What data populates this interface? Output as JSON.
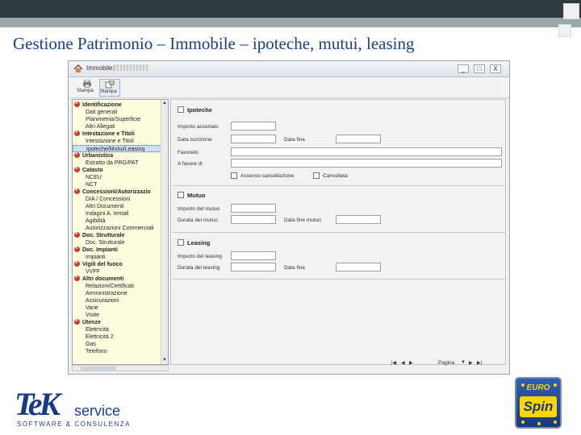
{
  "slide": {
    "title": "Gestione Patrimonio – Immobile – ipoteche, mutui, leasing"
  },
  "window": {
    "title": "Immobile:",
    "buttons": [
      "_",
      "□",
      "X"
    ]
  },
  "toolbar": {
    "buttons": [
      {
        "label": "Stampa",
        "icon": "printer-icon"
      },
      {
        "label": "Stampa",
        "icon": "print-preview-icon"
      }
    ]
  },
  "tree": {
    "items": [
      {
        "text": "Identificazione",
        "type": "group"
      },
      {
        "text": "Dati generali",
        "type": "child"
      },
      {
        "text": "Planimetria/Superficie",
        "type": "child"
      },
      {
        "text": "Altri Allegati",
        "type": "child"
      },
      {
        "text": "Intestazione e Titoli",
        "type": "group"
      },
      {
        "text": "Intestazione e Titoli",
        "type": "child"
      },
      {
        "text": "Ipoteche/Mutui/Leasing",
        "type": "child",
        "selected": true
      },
      {
        "text": "Urbanistica",
        "type": "group"
      },
      {
        "text": "Estratto da PRG/PAT",
        "type": "child"
      },
      {
        "text": "Catasto",
        "type": "group"
      },
      {
        "text": "NCEU",
        "type": "child"
      },
      {
        "text": "NCT",
        "type": "child"
      },
      {
        "text": "Concessioni/Autorizzazio",
        "type": "group"
      },
      {
        "text": "DIA / Concessioni",
        "type": "child"
      },
      {
        "text": "Altri Documenti",
        "type": "child"
      },
      {
        "text": "Indagini A. Ientali",
        "type": "child"
      },
      {
        "text": "Agibilità",
        "type": "child"
      },
      {
        "text": "Autorizzazioni Commerciali",
        "type": "child"
      },
      {
        "text": "Doc. Strutturale",
        "type": "group"
      },
      {
        "text": "Doc. Strutturale",
        "type": "child"
      },
      {
        "text": "Doc. Impianti",
        "type": "group"
      },
      {
        "text": "Impianti",
        "type": "child"
      },
      {
        "text": "Vigili del fuoco",
        "type": "group"
      },
      {
        "text": "VVFF",
        "type": "child"
      },
      {
        "text": "Altri documenti",
        "type": "group"
      },
      {
        "text": "Relazioni/Certificati",
        "type": "child"
      },
      {
        "text": "Amministrazione",
        "type": "child"
      },
      {
        "text": "Assicurazioni",
        "type": "child"
      },
      {
        "text": "Varie",
        "type": "child"
      },
      {
        "text": "Visite",
        "type": "child"
      },
      {
        "text": "Utenze",
        "type": "group"
      },
      {
        "text": "Elettricità",
        "type": "child"
      },
      {
        "text": "Elettricità 2",
        "type": "child"
      },
      {
        "text": "Gas",
        "type": "child"
      },
      {
        "text": "Telefono",
        "type": "child"
      }
    ]
  },
  "form": {
    "ipoteche": {
      "title": "Ipoteche",
      "importo_label": "Importo accertato",
      "data_iscrizione_label": "Data iscrizione",
      "data_fine_label": "Data fine",
      "favoreto_label": "Favoreto",
      "favore_di_label": "A favore di",
      "assenso_label": "Assenso cancellazione",
      "cancellata_label": "Cancellata"
    },
    "mutuo": {
      "title": "Mutuo",
      "importo_label": "Importo del mutuo",
      "durata_label": "Durata del mutuo",
      "data_fine_label": "Data fine mutuo"
    },
    "leasing": {
      "title": "Leasing",
      "importo_label": "Importo del leasing",
      "durata_label": "Durata del leasing",
      "data_fine_label": "Data fine"
    }
  },
  "footer_bar": {
    "pagina_label": "Pagina"
  },
  "logos": {
    "tek_name": "TeK",
    "tek_service": "service",
    "tek_sub": "SOFTWARE & CONSULENZA",
    "euro": "EURO",
    "spin": "Spin"
  },
  "colors": {
    "title_blue": "#1a3e8c",
    "tree_bg": "#fffde0",
    "group_dot": "#cc3b2c"
  }
}
